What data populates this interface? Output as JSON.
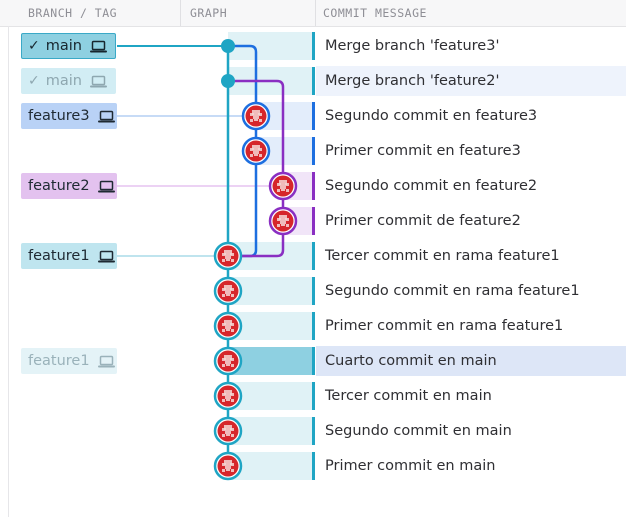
{
  "header": {
    "branch_tag": "BRANCH / TAG",
    "graph": "GRAPH",
    "commit_message": "COMMIT MESSAGE"
  },
  "refs": [
    {
      "label": "main",
      "check": true,
      "row": 0,
      "style": "head-active"
    },
    {
      "label": "main",
      "check": true,
      "row": 1,
      "style": "head-faded"
    },
    {
      "label": "feature3",
      "check": false,
      "row": 2,
      "style": "blue"
    },
    {
      "label": "feature2",
      "check": false,
      "row": 4,
      "style": "purple"
    },
    {
      "label": "feature1",
      "check": false,
      "row": 6,
      "style": "cyan"
    },
    {
      "label": "feature1",
      "check": false,
      "row": 9,
      "style": "cyan-faded"
    }
  ],
  "commits": [
    {
      "message": "Merge branch 'feature3'",
      "lane": 0,
      "lane_color": "cyan",
      "avatar": false
    },
    {
      "message": "Merge branch 'feature2'",
      "lane": 0,
      "lane_color": "cyan",
      "avatar": false
    },
    {
      "message": "Segundo commit en feature3",
      "lane": 1,
      "lane_color": "blue",
      "avatar": true
    },
    {
      "message": "Primer commit en feature3",
      "lane": 1,
      "lane_color": "blue",
      "avatar": true
    },
    {
      "message": "Segundo commit en feature2",
      "lane": 2,
      "lane_color": "purple",
      "avatar": true
    },
    {
      "message": "Primer commit de feature2",
      "lane": 2,
      "lane_color": "purple",
      "avatar": true
    },
    {
      "message": "Tercer commit en rama feature1",
      "lane": 0,
      "lane_color": "cyan",
      "avatar": true
    },
    {
      "message": "Segundo commit en rama feature1",
      "lane": 0,
      "lane_color": "cyan",
      "avatar": true
    },
    {
      "message": "Primer commit en rama feature1",
      "lane": 0,
      "lane_color": "cyan",
      "avatar": true
    },
    {
      "message": "Cuarto commit en main",
      "lane": 0,
      "lane_color": "cyan",
      "avatar": true,
      "selected": true
    },
    {
      "message": "Tercer commit en main",
      "lane": 0,
      "lane_color": "cyan",
      "avatar": true
    },
    {
      "message": "Segundo commit en main",
      "lane": 0,
      "lane_color": "cyan",
      "avatar": true
    },
    {
      "message": "Primer commit en main",
      "lane": 0,
      "lane_color": "cyan",
      "avatar": true
    }
  ],
  "colors": {
    "cyan": "#1fa5c4",
    "blue": "#1d6fe0",
    "purple": "#8a2fc2",
    "avatar": "#d6262b"
  }
}
